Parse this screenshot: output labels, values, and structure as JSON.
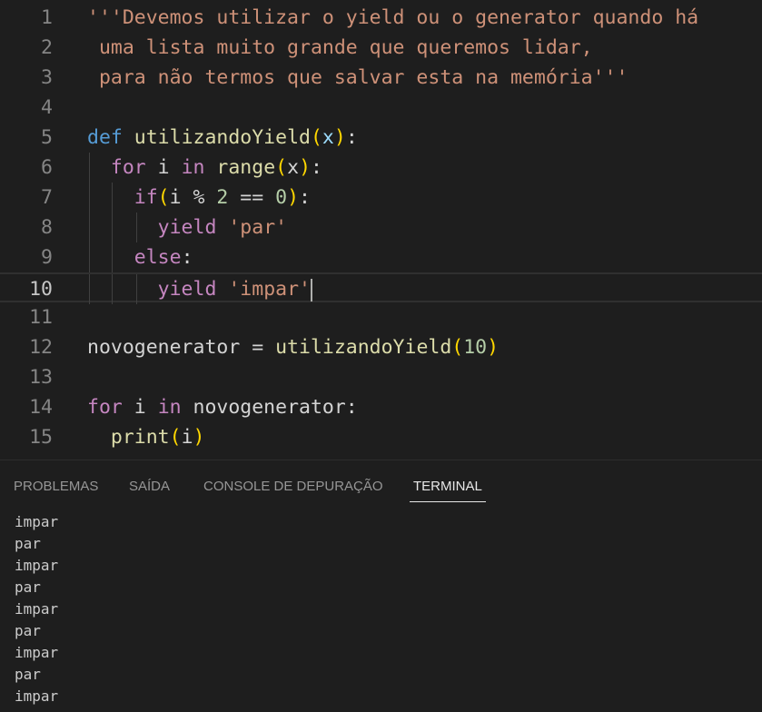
{
  "editor": {
    "current_line": "10",
    "lines": [
      {
        "n": "1",
        "tokens": [
          {
            "t": "'''Devemos utilizar o yield ou o generator quando há",
            "c": "str"
          }
        ]
      },
      {
        "n": "2",
        "tokens": [
          {
            "t": " uma lista muito grande que queremos lidar,",
            "c": "str"
          }
        ]
      },
      {
        "n": "3",
        "tokens": [
          {
            "t": " para não termos que salvar esta na memória'''",
            "c": "str"
          }
        ]
      },
      {
        "n": "4",
        "tokens": []
      },
      {
        "n": "5",
        "tokens": [
          {
            "t": "def",
            "c": "k-def"
          },
          {
            "t": " ",
            "c": "plain"
          },
          {
            "t": "utilizandoYield",
            "c": "fn"
          },
          {
            "t": "(",
            "c": "b1"
          },
          {
            "t": "x",
            "c": "var"
          },
          {
            "t": ")",
            "c": "b1"
          },
          {
            "t": ":",
            "c": "plain"
          }
        ]
      },
      {
        "n": "6",
        "tokens": [
          {
            "t": "  ",
            "c": "plain"
          },
          {
            "t": "for",
            "c": "k-ctrl"
          },
          {
            "t": " i ",
            "c": "plain"
          },
          {
            "t": "in",
            "c": "k-ctrl"
          },
          {
            "t": " ",
            "c": "plain"
          },
          {
            "t": "range",
            "c": "fn"
          },
          {
            "t": "(",
            "c": "b1"
          },
          {
            "t": "x",
            "c": "plain"
          },
          {
            "t": ")",
            "c": "b1"
          },
          {
            "t": ":",
            "c": "plain"
          }
        ]
      },
      {
        "n": "7",
        "tokens": [
          {
            "t": "    ",
            "c": "plain"
          },
          {
            "t": "if",
            "c": "k-ctrl"
          },
          {
            "t": "(",
            "c": "b1"
          },
          {
            "t": "i % ",
            "c": "plain"
          },
          {
            "t": "2",
            "c": "num"
          },
          {
            "t": " == ",
            "c": "plain"
          },
          {
            "t": "0",
            "c": "num"
          },
          {
            "t": ")",
            "c": "b1"
          },
          {
            "t": ":",
            "c": "plain"
          }
        ]
      },
      {
        "n": "8",
        "tokens": [
          {
            "t": "      ",
            "c": "plain"
          },
          {
            "t": "yield",
            "c": "k-ctrl"
          },
          {
            "t": " ",
            "c": "plain"
          },
          {
            "t": "'par'",
            "c": "str"
          }
        ]
      },
      {
        "n": "9",
        "tokens": [
          {
            "t": "    ",
            "c": "plain"
          },
          {
            "t": "else",
            "c": "k-ctrl"
          },
          {
            "t": ":",
            "c": "plain"
          }
        ]
      },
      {
        "n": "10",
        "tokens": [
          {
            "t": "      ",
            "c": "plain"
          },
          {
            "t": "yield",
            "c": "k-ctrl"
          },
          {
            "t": " ",
            "c": "plain"
          },
          {
            "t": "'impar'",
            "c": "str"
          }
        ]
      },
      {
        "n": "11",
        "tokens": []
      },
      {
        "n": "12",
        "tokens": [
          {
            "t": "novogenerator = ",
            "c": "plain"
          },
          {
            "t": "utilizandoYield",
            "c": "fn"
          },
          {
            "t": "(",
            "c": "b1"
          },
          {
            "t": "10",
            "c": "num"
          },
          {
            "t": ")",
            "c": "b1"
          }
        ]
      },
      {
        "n": "13",
        "tokens": []
      },
      {
        "n": "14",
        "tokens": [
          {
            "t": "for",
            "c": "k-ctrl"
          },
          {
            "t": " i ",
            "c": "plain"
          },
          {
            "t": "in",
            "c": "k-ctrl"
          },
          {
            "t": " novogenerator:",
            "c": "plain"
          }
        ]
      },
      {
        "n": "15",
        "tokens": [
          {
            "t": "  ",
            "c": "plain"
          },
          {
            "t": "print",
            "c": "fn"
          },
          {
            "t": "(",
            "c": "b1"
          },
          {
            "t": "i",
            "c": "plain"
          },
          {
            "t": ")",
            "c": "b1"
          }
        ]
      }
    ]
  },
  "panel": {
    "tabs": [
      {
        "label": "PROBLEMAS",
        "active": false
      },
      {
        "label": "SAÍDA",
        "active": false
      },
      {
        "label": "CONSOLE DE DEPURAÇÃO",
        "active": false
      },
      {
        "label": "TERMINAL",
        "active": true
      }
    ],
    "terminal_lines": [
      "impar",
      "par",
      "impar",
      "par",
      "impar",
      "par",
      "impar",
      "par",
      "impar"
    ]
  }
}
